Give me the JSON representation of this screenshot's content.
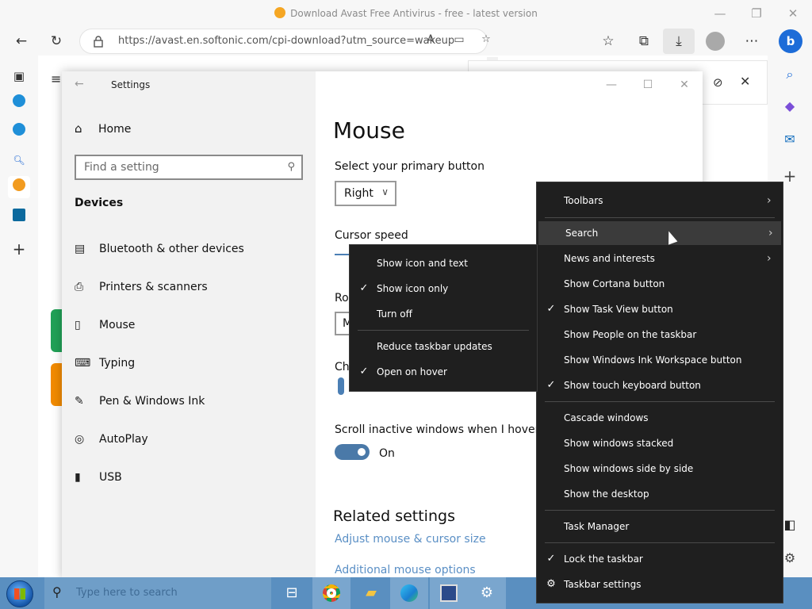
{
  "browser": {
    "title": "Download Avast Free Antivirus - free - latest version",
    "url": "https://avast.en.softonic.com/cpi-download?utm_source=wakeup",
    "bing_label": "b"
  },
  "settings": {
    "window_title": "Settings",
    "home": "Home",
    "search_placeholder": "Find a setting",
    "category": "Devices",
    "nav_items": [
      {
        "label": "Bluetooth & other devices",
        "icon": "▤"
      },
      {
        "label": "Printers & scanners",
        "icon": "⎙"
      },
      {
        "label": "Mouse",
        "icon": "▯"
      },
      {
        "label": "Typing",
        "icon": "⌨"
      },
      {
        "label": "Pen & Windows Ink",
        "icon": "✎"
      },
      {
        "label": "AutoPlay",
        "icon": "◎"
      },
      {
        "label": "USB",
        "icon": "▮"
      }
    ],
    "page_title": "Mouse",
    "primary_button_label": "Select your primary button",
    "primary_button_value": "Right",
    "cursor_speed_label": "Cursor speed",
    "roll_label_partial": "Rol",
    "roll_value_partial": "M",
    "choose_label_partial": "Che",
    "scroll_inactive_label": "Scroll inactive windows when I hover ove",
    "scroll_inactive_state": "On",
    "related_heading": "Related settings",
    "link1": "Adjust mouse & cursor size",
    "link2": "Additional mouse options"
  },
  "taskbar": {
    "search_placeholder": "Type here to search"
  },
  "context_menu": {
    "items": [
      {
        "label": "Toolbars",
        "checked": false,
        "submenu": true
      },
      {
        "label": "Search",
        "checked": false,
        "submenu": true,
        "hover": true
      },
      {
        "label": "News and interests",
        "checked": false,
        "submenu": true
      },
      {
        "label": "Show Cortana button",
        "checked": false
      },
      {
        "label": "Show Task View button",
        "checked": true
      },
      {
        "label": "Show People on the taskbar",
        "checked": false
      },
      {
        "label": "Show Windows Ink Workspace button",
        "checked": false
      },
      {
        "label": "Show touch keyboard button",
        "checked": true
      },
      {
        "label": "Cascade windows",
        "checked": false
      },
      {
        "label": "Show windows stacked",
        "checked": false
      },
      {
        "label": "Show windows side by side",
        "checked": false
      },
      {
        "label": "Show the desktop",
        "checked": false
      },
      {
        "label": "Task Manager",
        "checked": false
      },
      {
        "label": "Lock the taskbar",
        "checked": true
      },
      {
        "label": "Taskbar settings",
        "checked": false,
        "icon": "gear"
      }
    ]
  },
  "submenu": {
    "items": [
      {
        "label": "Show icon and text",
        "checked": false
      },
      {
        "label": "Show icon only",
        "checked": true
      },
      {
        "label": "Turn off",
        "checked": false
      },
      {
        "label": "Reduce taskbar updates",
        "checked": false
      },
      {
        "label": "Open on hover",
        "checked": true
      }
    ]
  },
  "colors": {
    "menu_bg": "#1f1f1f",
    "taskbar": "#5a8fc0",
    "link": "#5a8fc5",
    "toggle": "#4a79a8"
  }
}
